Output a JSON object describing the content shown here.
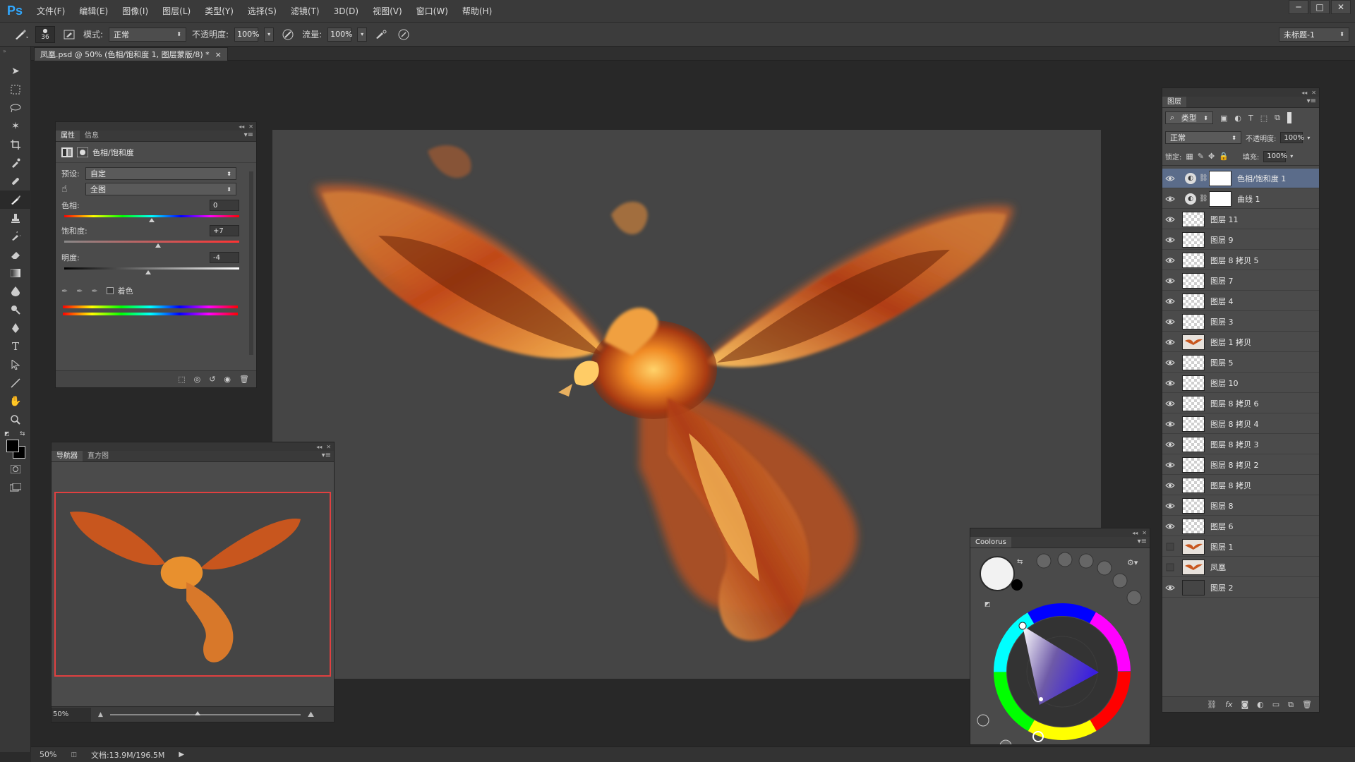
{
  "app": {
    "logo": "Ps"
  },
  "menu": [
    "文件(F)",
    "编辑(E)",
    "图像(I)",
    "图层(L)",
    "类型(Y)",
    "选择(S)",
    "滤镜(T)",
    "3D(D)",
    "视图(V)",
    "窗口(W)",
    "帮助(H)"
  ],
  "window_buttons": [
    "─",
    "□",
    "✕"
  ],
  "options": {
    "brush_size": "36",
    "mode_label": "模式:",
    "mode_value": "正常",
    "opacity_label": "不透明度:",
    "opacity_value": "100%",
    "flow_label": "流量:",
    "flow_value": "100%",
    "workspace_value": "未标题-1"
  },
  "document_tab": {
    "title": "凤凰.psd @ 50% (色相/饱和度 1, 图层蒙版/8) *",
    "close": "×"
  },
  "properties": {
    "tabs": [
      "属性",
      "信息"
    ],
    "title": "色相/饱和度",
    "preset_label": "预设:",
    "preset_value": "自定",
    "range_value": "全图",
    "hue_label": "色相:",
    "hue_value": "0",
    "hue_position": 0.5,
    "sat_label": "饱和度:",
    "sat_value": "+7",
    "sat_position": 0.535,
    "light_label": "明度:",
    "light_value": "-4",
    "light_position": 0.48,
    "colorize_label": "着色"
  },
  "navigator": {
    "tabs": [
      "导航器",
      "直方图"
    ],
    "zoom_value": "50%"
  },
  "layers": {
    "tab": "图层",
    "filter_value": "类型",
    "blend_value": "正常",
    "opacity_label": "不透明度:",
    "opacity_value": "100%",
    "lock_label": "锁定:",
    "fill_label": "填充:",
    "fill_value": "100%",
    "rows": [
      {
        "name": "色相/饱和度 1",
        "kind": "adjustment",
        "visible": true,
        "selected": true
      },
      {
        "name": "曲线 1",
        "kind": "adjustment",
        "visible": true,
        "selected": false
      },
      {
        "name": "图层 11",
        "kind": "pixel",
        "visible": true,
        "selected": false
      },
      {
        "name": "图层 9",
        "kind": "pixel",
        "visible": true,
        "selected": false
      },
      {
        "name": "图层 8 拷贝 5",
        "kind": "pixel",
        "visible": true,
        "selected": false
      },
      {
        "name": "图层 7",
        "kind": "pixel",
        "visible": true,
        "selected": false
      },
      {
        "name": "图层 4",
        "kind": "pixel",
        "visible": true,
        "selected": false
      },
      {
        "name": "图层 3",
        "kind": "pixel",
        "visible": true,
        "selected": false
      },
      {
        "name": "图层 1 拷贝",
        "kind": "image",
        "visible": true,
        "selected": false
      },
      {
        "name": "图层 5",
        "kind": "pixel",
        "visible": true,
        "selected": false
      },
      {
        "name": "图层 10",
        "kind": "pixel",
        "visible": true,
        "selected": false
      },
      {
        "name": "图层 8 拷贝 6",
        "kind": "pixel",
        "visible": true,
        "selected": false
      },
      {
        "name": "图层 8 拷贝 4",
        "kind": "pixel",
        "visible": true,
        "selected": false
      },
      {
        "name": "图层 8 拷贝 3",
        "kind": "pixel",
        "visible": true,
        "selected": false
      },
      {
        "name": "图层 8 拷贝 2",
        "kind": "pixel",
        "visible": true,
        "selected": false
      },
      {
        "name": "图层 8 拷贝",
        "kind": "pixel",
        "visible": true,
        "selected": false
      },
      {
        "name": "图层 8",
        "kind": "pixel",
        "visible": true,
        "selected": false
      },
      {
        "name": "图层 6",
        "kind": "pixel",
        "visible": true,
        "selected": false
      },
      {
        "name": "图层 1",
        "kind": "image",
        "visible": false,
        "selected": false
      },
      {
        "name": "凤凰",
        "kind": "image",
        "visible": false,
        "selected": false
      },
      {
        "name": "图层 2",
        "kind": "solid",
        "visible": true,
        "selected": false
      }
    ]
  },
  "coolorus": {
    "title": "Coolorus"
  },
  "status": {
    "zoom": "50%",
    "doc": "文档:13.9M/196.5M"
  },
  "colors": {
    "accent_selected": "#5b6c8a",
    "canvas": "#454545",
    "panel": "#4b4b4b",
    "navigator_frame": "#e04040"
  }
}
